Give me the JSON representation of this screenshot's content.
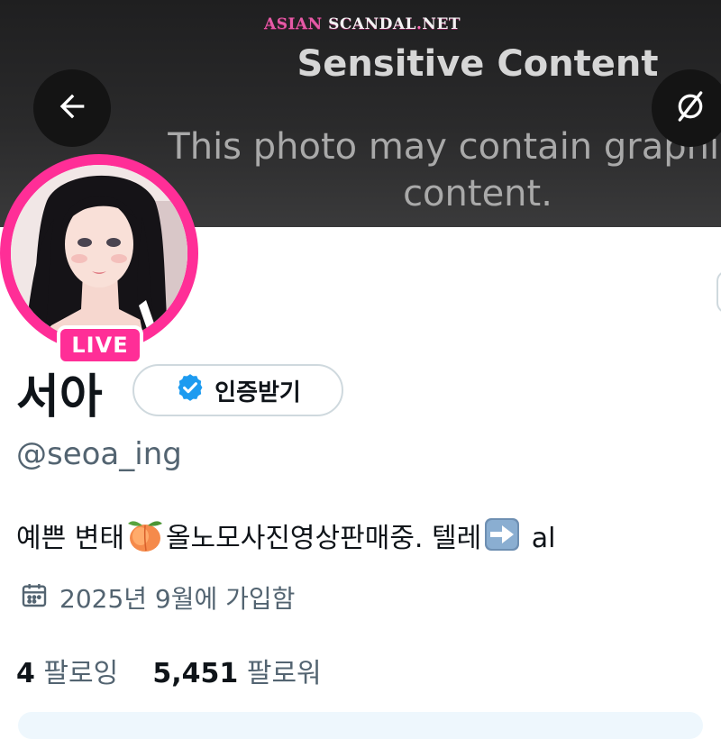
{
  "banner": {
    "watermark": {
      "part1": "ASIAN",
      "part2": "SCANDAL",
      "dot": ".",
      "part3": "NET"
    },
    "sensitive_title": "Sensitive Content",
    "sensitive_line1": "This photo may contain graphic or",
    "sensitive_line2": "content.",
    "back_icon": "arrow-left-icon",
    "hide_icon": "eye-off-icon"
  },
  "profile": {
    "live_badge": "LIVE",
    "name": "서아",
    "verify_label": "인증받기",
    "verify_icon": "verified-badge-icon",
    "handle": "@seoa_ing",
    "bio": {
      "part1": "예쁜 변태",
      "part2": "올노모사진영상판매중. 텔레",
      "part3": "al"
    },
    "joined": "2025년 9월에 가입함",
    "following_count": "4",
    "following_label": "팔로잉",
    "followers_count": "5,451",
    "followers_label": "팔로워"
  },
  "colors": {
    "accent_pink": "#ff2e97",
    "verified_blue": "#1d9bf0",
    "muted_text": "#536471",
    "primary_text": "#0f1419"
  }
}
